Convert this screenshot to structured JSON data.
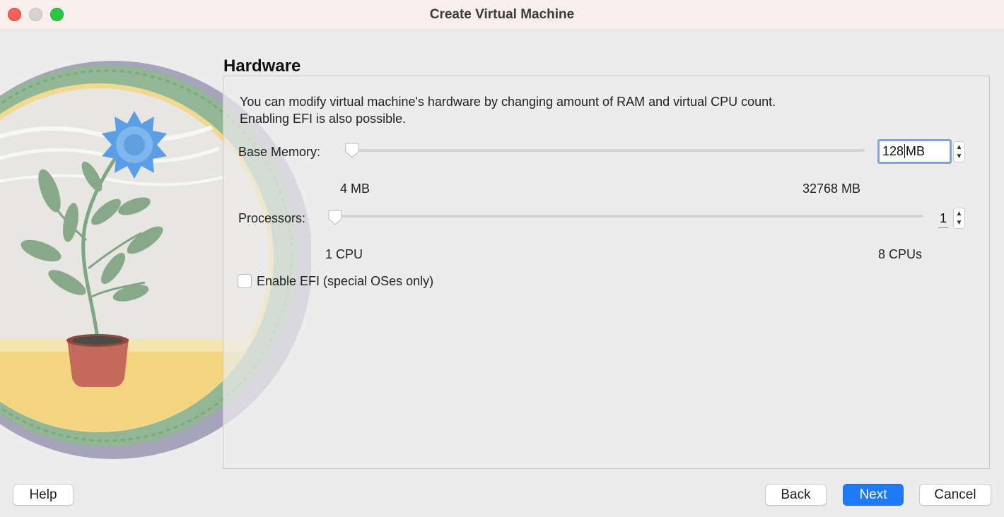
{
  "window": {
    "title": "Create Virtual Machine"
  },
  "page": {
    "title": "Hardware",
    "description_line1": "You can modify virtual machine's hardware by changing amount of RAM and virtual CPU count.",
    "description_line2": "Enabling EFI is also possible."
  },
  "memory": {
    "label": "Base Memory:",
    "value": "128",
    "unit": "MB",
    "min_label": "4 MB",
    "max_label": "32768 MB",
    "slider_fraction": 0.004
  },
  "processors": {
    "label": "Processors:",
    "value": "1",
    "min_label": "1 CPU",
    "max_label": "8 CPUs",
    "slider_fraction": 0
  },
  "efi": {
    "label": "Enable EFI (special OSes only)",
    "checked": false
  },
  "buttons": {
    "help": "Help",
    "back": "Back",
    "next": "Next",
    "cancel": "Cancel"
  },
  "icons": {
    "stepper_up": "▲",
    "stepper_down": "▼",
    "illustration": "potted-flower-illustration"
  },
  "colors": {
    "accent": "#1f7bf5",
    "focus_ring": "#74a6ea"
  }
}
